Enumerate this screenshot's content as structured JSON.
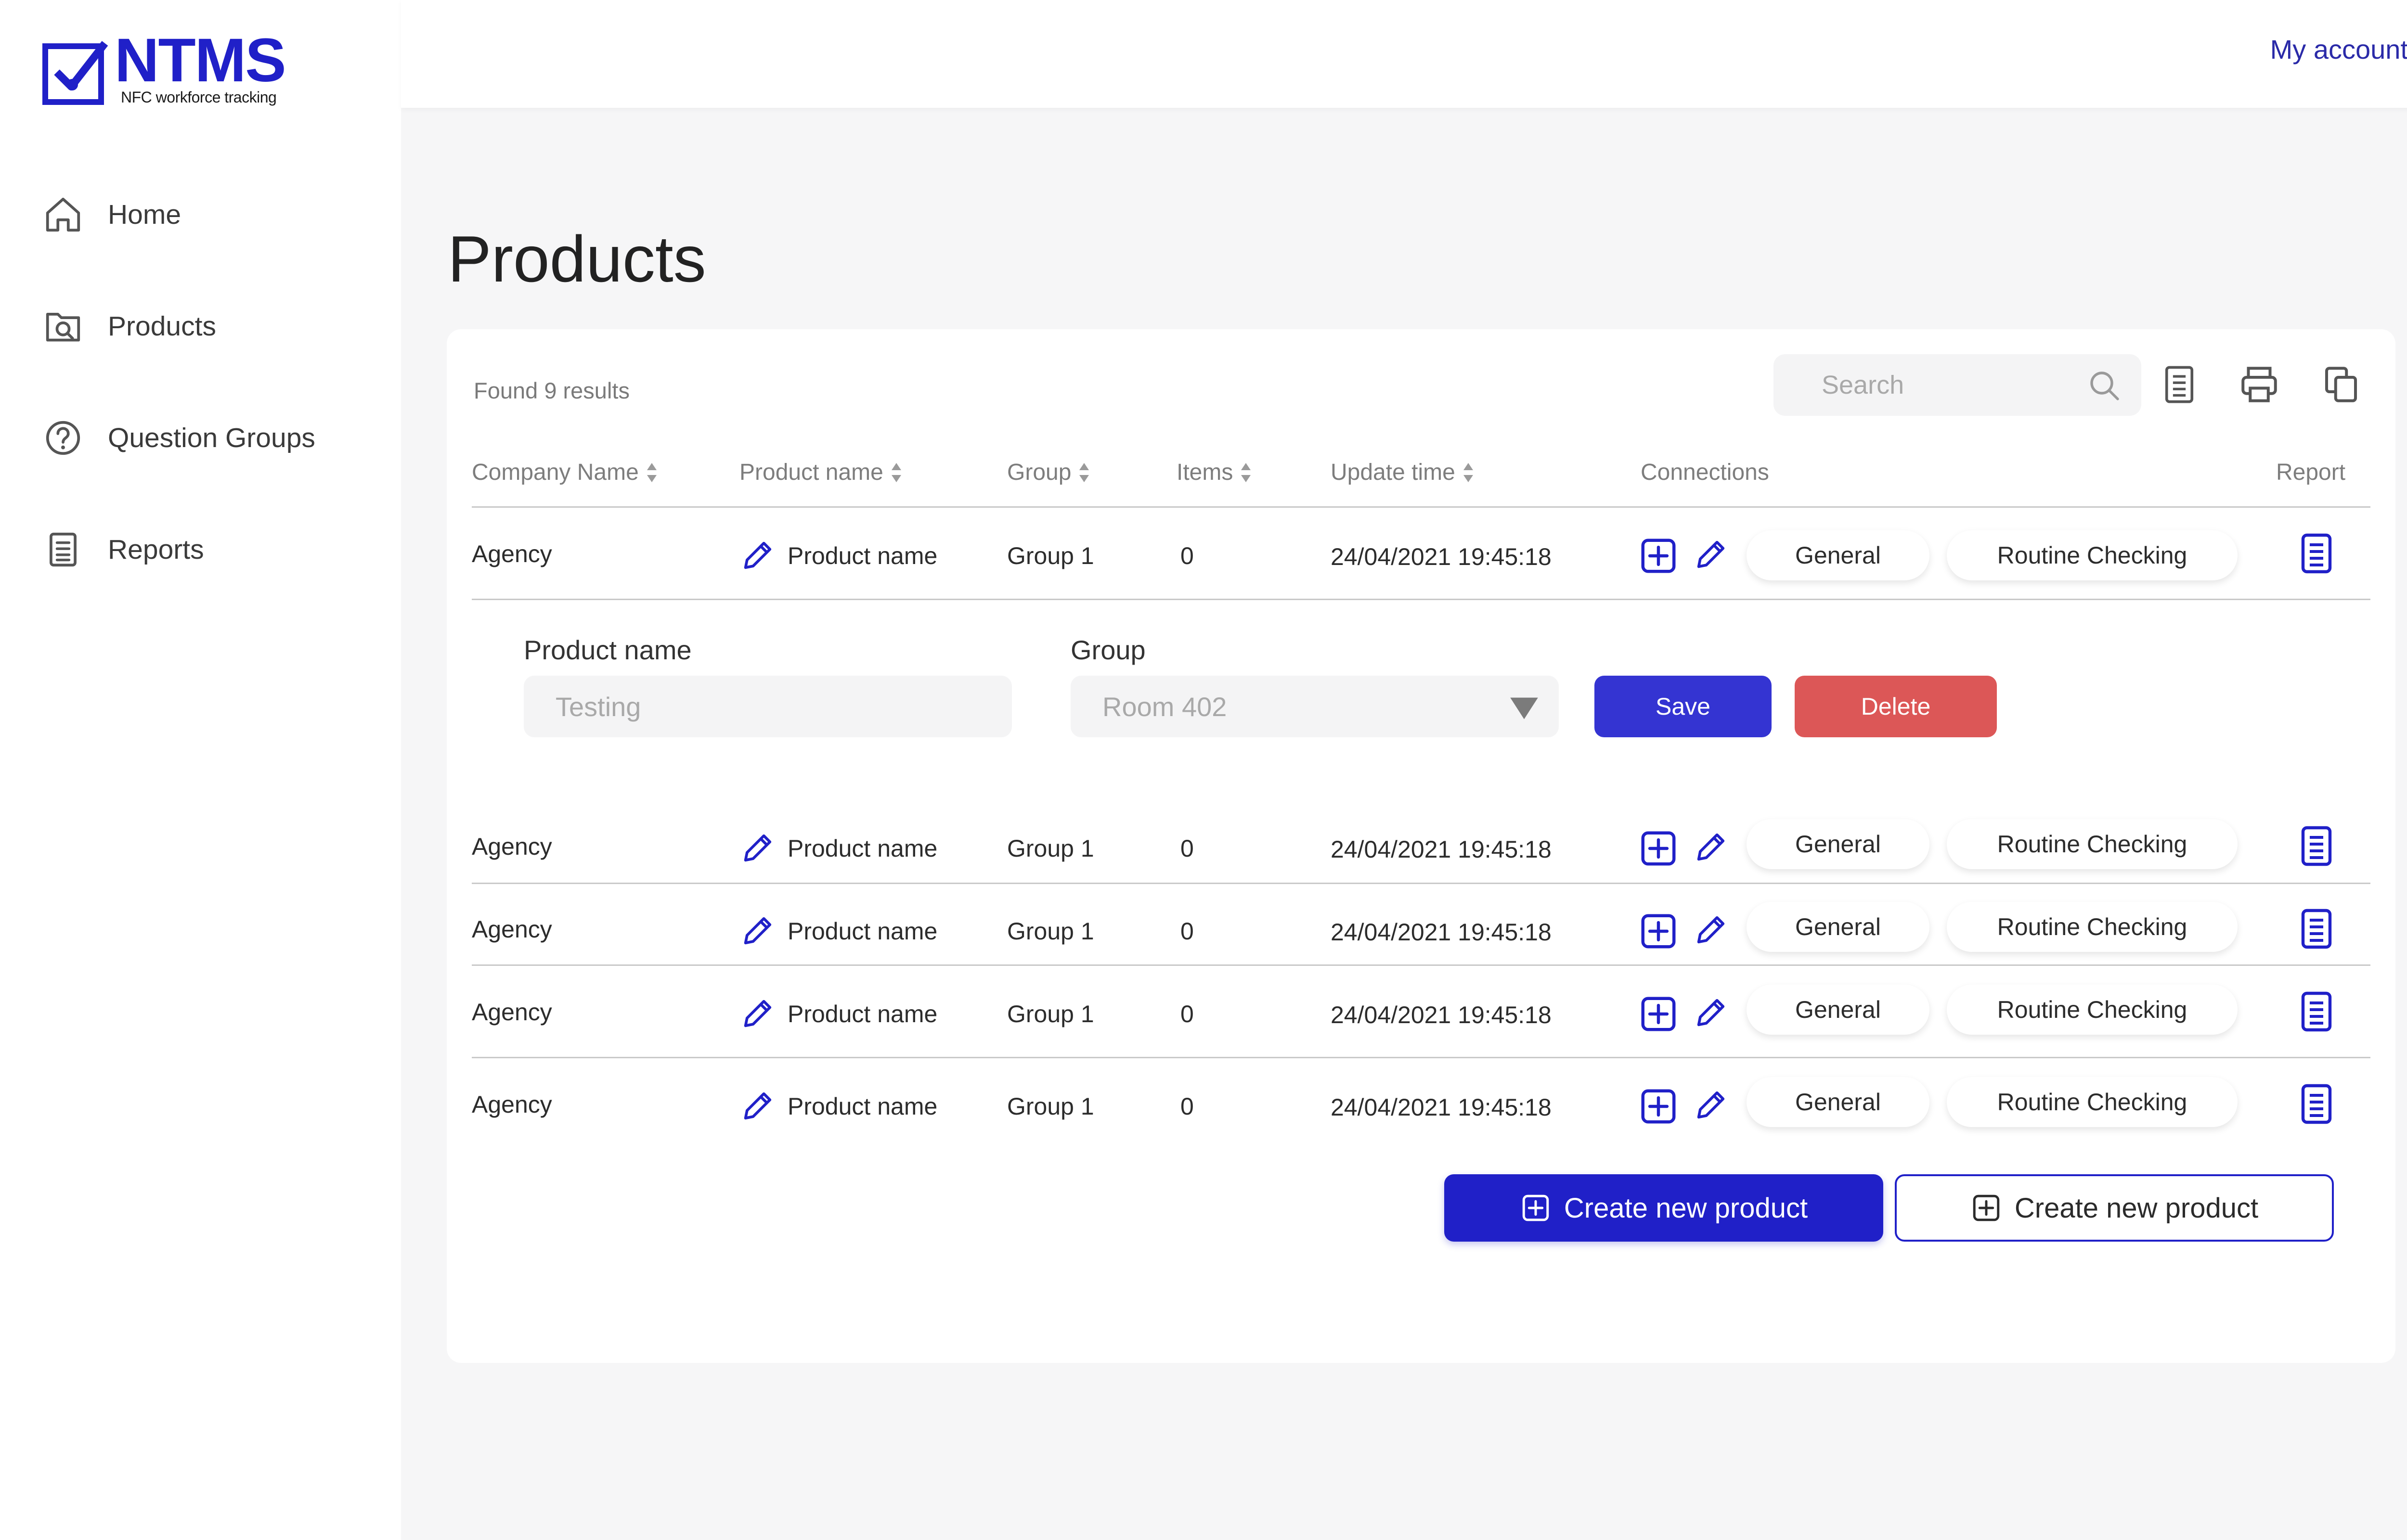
{
  "brand": {
    "name": "NTMS",
    "tagline": "NFC workforce tracking",
    "accent": "#2020c8"
  },
  "account": {
    "label": "My account"
  },
  "sidebar": {
    "items": [
      {
        "label": "Home",
        "icon": "home-icon"
      },
      {
        "label": "Products",
        "icon": "products-search-icon"
      },
      {
        "label": "Question Groups",
        "icon": "question-icon"
      },
      {
        "label": "Reports",
        "icon": "report-icon"
      }
    ]
  },
  "page": {
    "title": "Products"
  },
  "results": {
    "found": "Found 9 results"
  },
  "search": {
    "placeholder": "Search"
  },
  "table": {
    "headers": {
      "company": "Company Name",
      "product": "Product name",
      "group": "Group",
      "items": "Items",
      "update": "Update time",
      "connections": "Connections",
      "report": "Report"
    },
    "rows": [
      {
        "company": "Agency",
        "product": "Product name",
        "group": "Group 1",
        "items": "0",
        "update": "24/04/2021 19:45:18",
        "chip1": "General",
        "chip2": "Routine Checking"
      },
      {
        "company": "Agency",
        "product": "Product name",
        "group": "Group 1",
        "items": "0",
        "update": "24/04/2021 19:45:18",
        "chip1": "General",
        "chip2": "Routine Checking"
      },
      {
        "company": "Agency",
        "product": "Product name",
        "group": "Group 1",
        "items": "0",
        "update": "24/04/2021 19:45:18",
        "chip1": "General",
        "chip2": "Routine Checking"
      },
      {
        "company": "Agency",
        "product": "Product name",
        "group": "Group 1",
        "items": "0",
        "update": "24/04/2021 19:45:18",
        "chip1": "General",
        "chip2": "Routine Checking"
      },
      {
        "company": "Agency",
        "product": "Product name",
        "group": "Group 1",
        "items": "0",
        "update": "24/04/2021 19:45:18",
        "chip1": "General",
        "chip2": "Routine Checking"
      }
    ]
  },
  "edit": {
    "product_label": "Product name",
    "product_value": "Testing",
    "group_label": "Group",
    "group_value": "Room 402",
    "save": "Save",
    "delete": "Delete"
  },
  "actions": {
    "create_primary": "Create new product",
    "create_secondary": "Create new product"
  },
  "colors": {
    "primary": "#2020c8",
    "save": "#3434d2",
    "delete": "#dc5757",
    "border": "#c9c9c9"
  }
}
